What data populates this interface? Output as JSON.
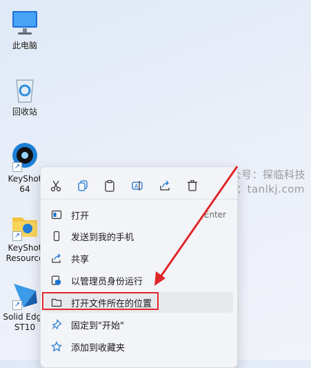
{
  "desktop": {
    "icons": [
      {
        "label": "此电脑"
      },
      {
        "label": "回收站"
      },
      {
        "label": "KeyShot",
        "label2": "64"
      },
      {
        "label": "KeyShot",
        "label2": "Resource"
      },
      {
        "label": "Solid Edge",
        "label2": "ST10"
      }
    ]
  },
  "menu": {
    "toolbar": [
      "cut-icon",
      "copy-icon",
      "paste-icon",
      "rename-icon",
      "share-icon",
      "delete-icon"
    ],
    "items": [
      {
        "label": "打开",
        "accel": "Enter",
        "icon": "open-icon"
      },
      {
        "label": "发送到我的手机",
        "icon": "phone-icon"
      },
      {
        "label": "共享",
        "icon": "share-icon"
      },
      {
        "label": "以管理员身份运行",
        "icon": "shield-icon"
      },
      {
        "label": "打开文件所在的位置",
        "icon": "folder-icon"
      },
      {
        "label": "固定到\"开始\"",
        "icon": "pin-icon"
      },
      {
        "label": "添加到收藏夹",
        "icon": "star-icon"
      }
    ]
  },
  "watermark": {
    "line1": "微信公众号：探临科技",
    "line2": "官网：tanlkj.com"
  },
  "colors": {
    "annotation": "#e0262b",
    "accent": "#1565c0"
  }
}
